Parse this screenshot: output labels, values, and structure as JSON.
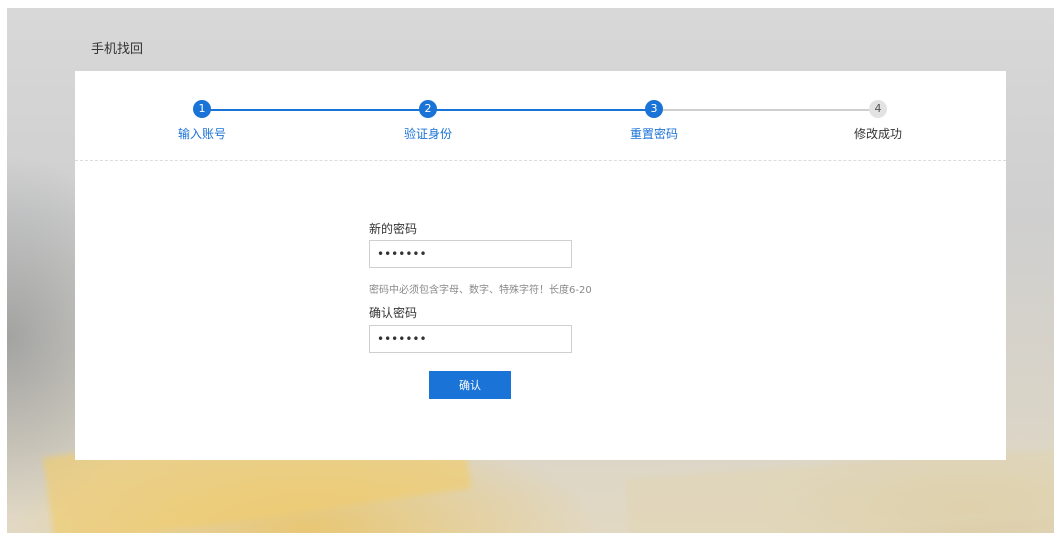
{
  "page": {
    "title": "手机找回"
  },
  "steps": [
    {
      "number": "1",
      "label": "输入账号",
      "state": "done"
    },
    {
      "number": "2",
      "label": "验证身份",
      "state": "done"
    },
    {
      "number": "3",
      "label": "重置密码",
      "state": "active"
    },
    {
      "number": "4",
      "label": "修改成功",
      "state": "pending"
    }
  ],
  "form": {
    "new_password_label": "新的密码",
    "new_password_value": "1234567",
    "hint": "密码中必须包含字母、数字、特殊字符！长度6-20",
    "confirm_password_label": "确认密码",
    "confirm_password_value": "1234567",
    "submit_label": "确认"
  },
  "colors": {
    "accent": "#1a73d6",
    "inactive": "#cfcfcf"
  }
}
